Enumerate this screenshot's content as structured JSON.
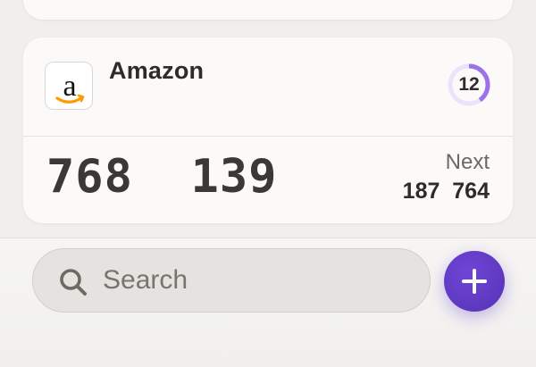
{
  "account": {
    "name": "Amazon",
    "logo_icon": "amazon-logo-icon",
    "timer_seconds": "12",
    "timer_remaining_fraction": 0.4,
    "current_code": "768  139",
    "next_label": "Next",
    "next_code": "187  764"
  },
  "search": {
    "placeholder": "Search",
    "icon": "search-icon"
  },
  "add_button": {
    "icon": "plus-icon"
  },
  "colors": {
    "accent": "#5a36bf",
    "timer_ring": "#9c72ea",
    "timer_track": "#ebe2fb",
    "amazon_orange": "#ff9900"
  }
}
